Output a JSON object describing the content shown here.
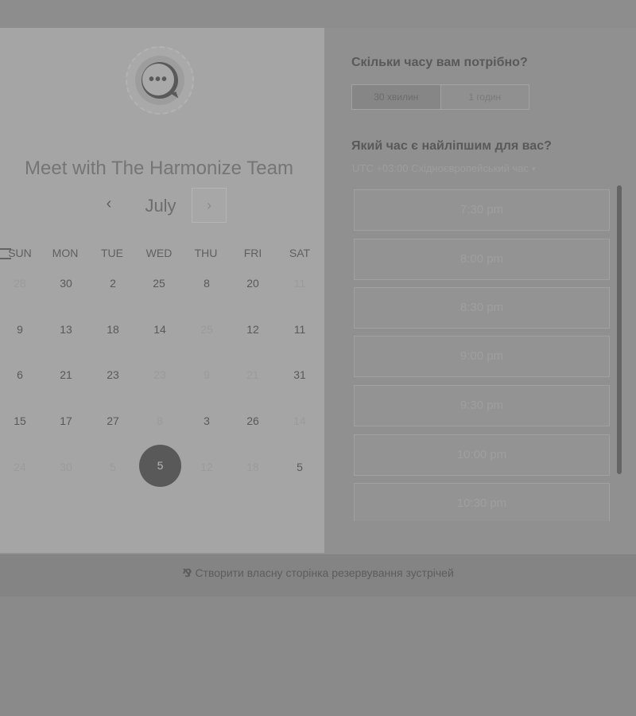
{
  "meeting": {
    "title": "Meet with The Harmonize Team",
    "avatar_icon": "chat-bubble-icon",
    "avatar_glyph": "•••"
  },
  "calendar": {
    "month": "July",
    "prev_glyph": "‹",
    "next_glyph": "›",
    "weekdays": [
      "SUN",
      "MON",
      "TUE",
      "WED",
      "THU",
      "FRI",
      "SAT"
    ],
    "weeks": [
      [
        "28",
        "30",
        "2",
        "25",
        "8",
        "20",
        "11"
      ],
      [
        "9",
        "13",
        "18",
        "14",
        "25",
        "12",
        "11"
      ],
      [
        "6",
        "21",
        "23",
        "23",
        "9",
        "21",
        "31"
      ],
      [
        "15",
        "17",
        "27",
        "8",
        "3",
        "26",
        "14"
      ],
      [
        "24",
        "30",
        "5",
        "5",
        "12",
        "18",
        "5"
      ]
    ],
    "selected_day": "5"
  },
  "duration": {
    "question": "Скільки часу вам потрібно?",
    "options": [
      "30 хвилин",
      "1 годин"
    ],
    "selected": "30 хвилин"
  },
  "time": {
    "question": "Який час є найліпшим для вас?",
    "timezone": "UTC +03:00 Східноєвропейський час",
    "timezone_caret": "▾",
    "slots": [
      "7:30 pm",
      "8:00 pm",
      "8:30 pm",
      "9:00 pm",
      "9:30 pm",
      "10:00 pm",
      "10:30 pm"
    ]
  },
  "footer": {
    "icon": "hubspot-sprocket-icon",
    "icon_glyph": "⅋",
    "link_text": "Створити власну сторінка резервування зустрічей"
  },
  "colors": {
    "selected_day_bg": "#595959",
    "overlay": "#8a8a8a"
  }
}
